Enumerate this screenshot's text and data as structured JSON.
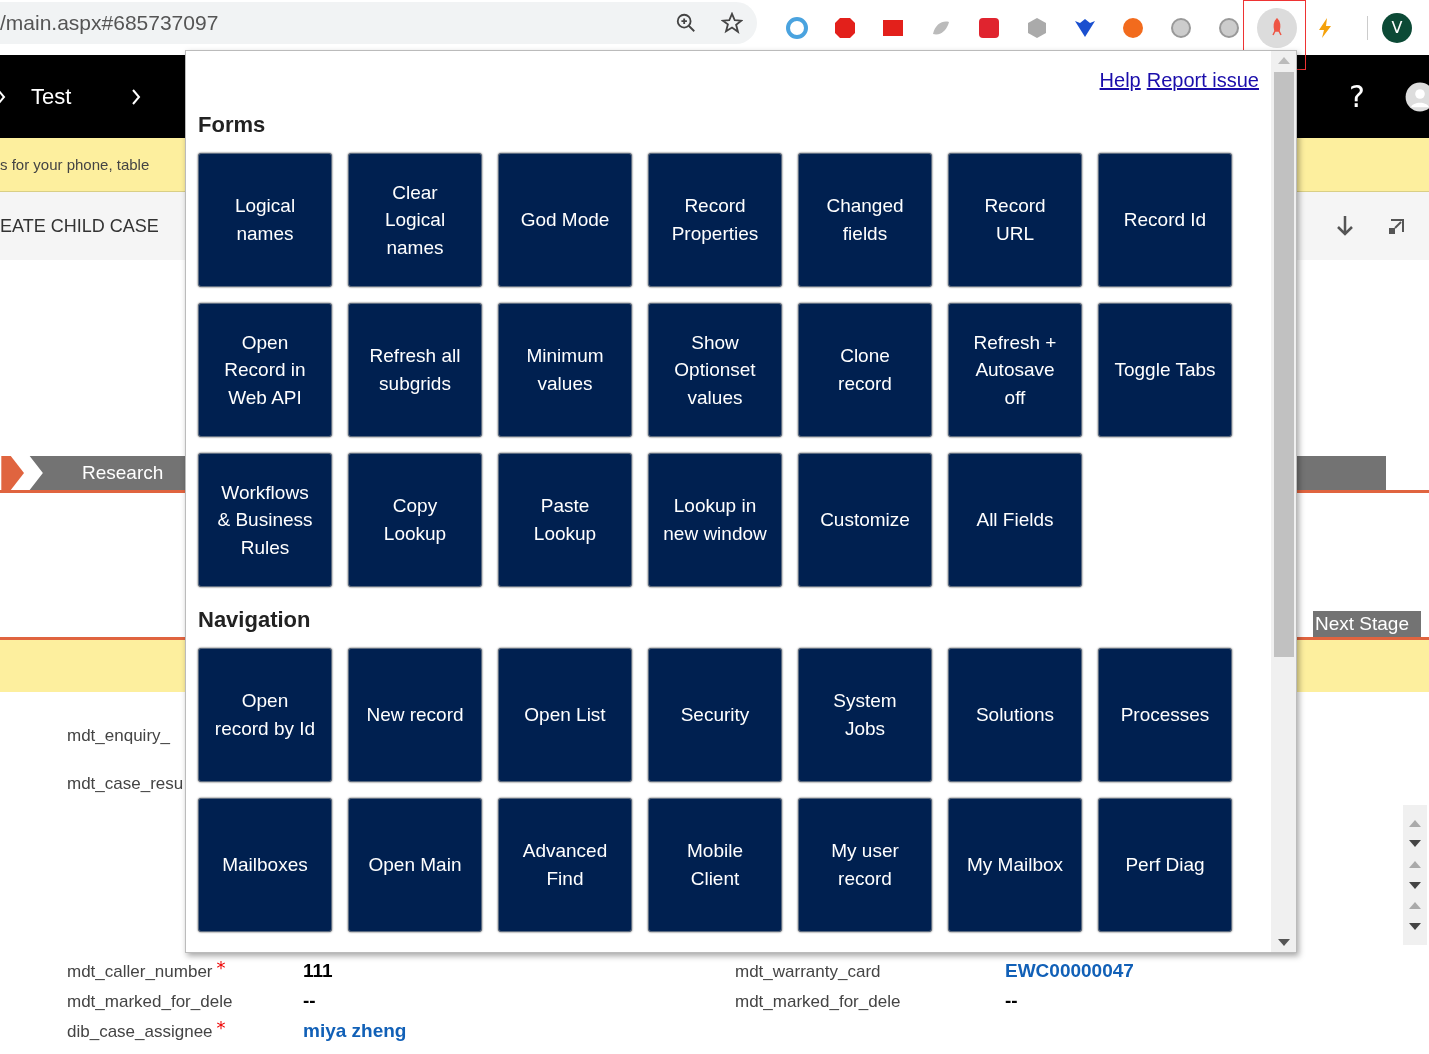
{
  "browser": {
    "address": "/main.aspx#685737097",
    "extensions": [
      {
        "selected": false
      },
      {
        "selected": false
      },
      {
        "selected": false
      },
      {
        "selected": false
      },
      {
        "selected": false
      },
      {
        "selected": false
      },
      {
        "selected": false
      },
      {
        "selected": false
      },
      {
        "selected": false
      },
      {
        "selected": false
      },
      {
        "selected": true
      },
      {
        "selected": false
      }
    ],
    "profile": "V"
  },
  "header": {
    "breadcrumb": "Test",
    "help": "?"
  },
  "notice": "s for your phone, table",
  "command_bar": {
    "command": "EATE CHILD CASE"
  },
  "process": {
    "stage": "Research",
    "next_button": "Next Stage"
  },
  "fields_upper": [
    "mdt_enquiry_",
    "mdt_case_resu"
  ],
  "fields": [
    {
      "label": "mdt_caller_number",
      "marker": "*",
      "value": "111",
      "kind": "text"
    },
    {
      "label": "mdt_warranty_card",
      "value": "EWC00000047",
      "kind": "link"
    },
    {
      "label": "mdt_marked_for_dele",
      "value": "--",
      "kind": "text"
    },
    {
      "label": "mdt_marked_for_dele",
      "value": "--",
      "kind": "text"
    },
    {
      "label": "dib_case_assignee",
      "marker": "*",
      "value": "miya zheng",
      "kind": "link"
    }
  ],
  "popup": {
    "links": [
      "Help",
      "Report issue"
    ],
    "sections": [
      {
        "title": "Forms",
        "tiles": [
          "Logical names",
          "Clear Logical names",
          "God Mode",
          "Record Properties",
          "Changed fields",
          "Record URL",
          "Record Id",
          "Open Record in Web API",
          "Refresh all subgrids",
          "Minimum values",
          "Show Optionset values",
          "Clone record",
          "Refresh + Autosave off",
          "Toggle Tabs",
          "Workflows & Business Rules",
          "Copy Lookup",
          "Paste Lookup",
          "Lookup in new window",
          "Customize",
          "All Fields"
        ]
      },
      {
        "title": "Navigation",
        "tiles": [
          "Open record by Id",
          "New record",
          "Open List",
          "Security",
          "System Jobs",
          "Solutions",
          "Processes",
          "Mailboxes",
          "Open Main",
          "Advanced Find",
          "Mobile Client",
          "My user record",
          "My Mailbox",
          "Perf Diag"
        ]
      }
    ]
  }
}
